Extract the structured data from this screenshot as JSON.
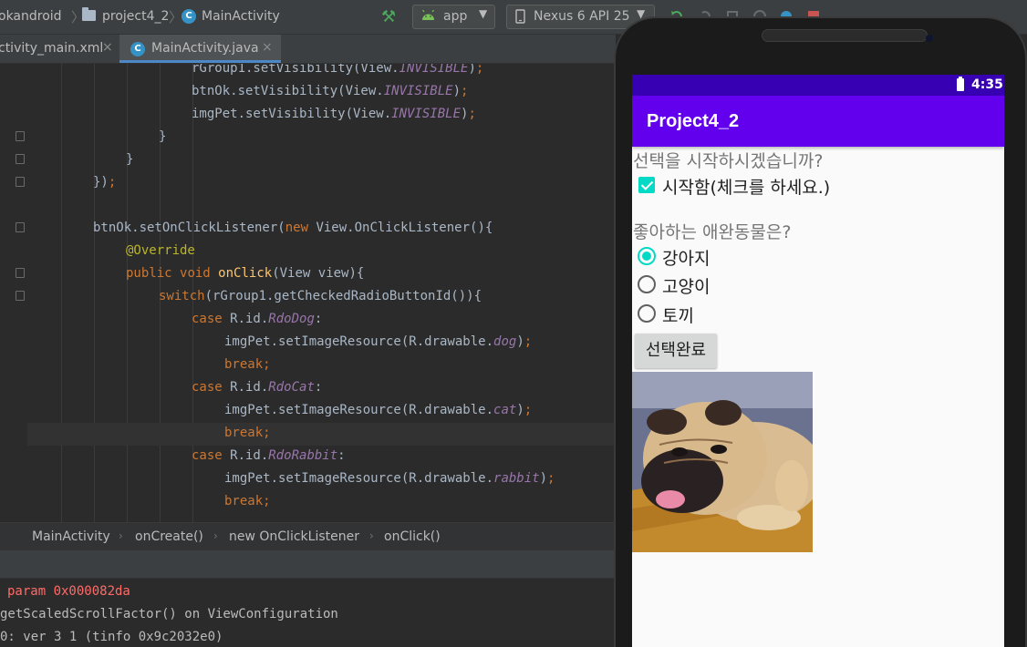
{
  "toolbar": {
    "crumbs": [
      "okandroid",
      "project4_2",
      "MainActivity"
    ],
    "module_selector": "app",
    "device_selector": "Nexus 6 API 25"
  },
  "tabs": [
    {
      "label": "ctivity_main.xml",
      "close": "×"
    },
    {
      "label": "MainActivity.java",
      "close": "×"
    }
  ],
  "editor": {
    "lines": [
      {
        "t": "rGroup1.setVisibility(View.INVISIBLE);"
      },
      {
        "t": "btnOk.setVisibility(View.INVISIBLE);"
      },
      {
        "t": "imgPet.setVisibility(View.INVISIBLE);"
      },
      {
        "t": "}"
      },
      {
        "t": "}"
      },
      {
        "t": "});"
      },
      {
        "t": ""
      },
      {
        "t": "btnOk.setOnClickListener(new View.OnClickListener(){"
      },
      {
        "t": "@Override"
      },
      {
        "t": "public void onClick(View view){"
      },
      {
        "t": "switch(rGroup1.getCheckedRadioButtonId()){"
      },
      {
        "t": "case R.id.RdoDog:"
      },
      {
        "t": "imgPet.setImageResource(R.drawable.dog);"
      },
      {
        "t": "break;"
      },
      {
        "t": "case R.id.RdoCat:"
      },
      {
        "t": "imgPet.setImageResource(R.drawable.cat);"
      },
      {
        "t": "break;"
      },
      {
        "t": "case R.id.RdoRabbit:"
      },
      {
        "t": "imgPet.setImageResource(R.drawable.rabbit);"
      },
      {
        "t": "break;"
      }
    ]
  },
  "breadcrumb": [
    "MainActivity",
    "onCreate()",
    "new OnClickListener",
    "onClick()"
  ],
  "logcat": [
    "param 0x000082da",
    "getScaledScrollFactor() on ViewConfiguration",
    "0: ver 3 1 (tinfo 0x9c2032e0)"
  ],
  "emulator": {
    "clock": "4:35",
    "app_title": "Project4_2",
    "prompt_start": "선택을 시작하시겠습니까?",
    "checkbox_label": "시작함(체크를 하세요.)",
    "checkbox_checked": true,
    "prompt_pet": "좋아하는 애완동물은?",
    "options": [
      {
        "label": "강아지",
        "checked": true
      },
      {
        "label": "고양이",
        "checked": false
      },
      {
        "label": "토끼",
        "checked": false
      }
    ],
    "button_label": "선택완료",
    "image": "pug-dog-photo"
  },
  "colors": {
    "status_bar": "#3700b3",
    "app_bar": "#6200ee",
    "accent": "#03dac5",
    "ide_bg": "#2b2b2b"
  }
}
